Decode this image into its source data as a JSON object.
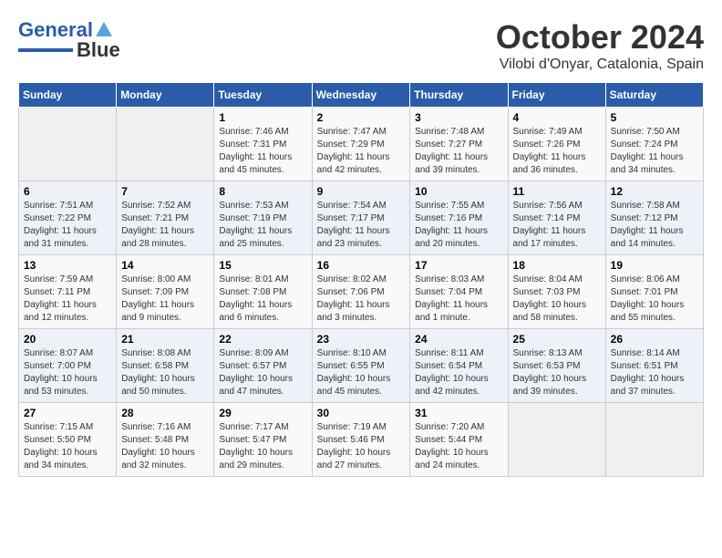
{
  "logo": {
    "line1": "General",
    "line2": "Blue"
  },
  "title": "October 2024",
  "subtitle": "Vilobi d'Onyar, Catalonia, Spain",
  "days_of_week": [
    "Sunday",
    "Monday",
    "Tuesday",
    "Wednesday",
    "Thursday",
    "Friday",
    "Saturday"
  ],
  "weeks": [
    [
      {
        "day": "",
        "info": ""
      },
      {
        "day": "",
        "info": ""
      },
      {
        "day": "1",
        "info": "Sunrise: 7:46 AM\nSunset: 7:31 PM\nDaylight: 11 hours and 45 minutes."
      },
      {
        "day": "2",
        "info": "Sunrise: 7:47 AM\nSunset: 7:29 PM\nDaylight: 11 hours and 42 minutes."
      },
      {
        "day": "3",
        "info": "Sunrise: 7:48 AM\nSunset: 7:27 PM\nDaylight: 11 hours and 39 minutes."
      },
      {
        "day": "4",
        "info": "Sunrise: 7:49 AM\nSunset: 7:26 PM\nDaylight: 11 hours and 36 minutes."
      },
      {
        "day": "5",
        "info": "Sunrise: 7:50 AM\nSunset: 7:24 PM\nDaylight: 11 hours and 34 minutes."
      }
    ],
    [
      {
        "day": "6",
        "info": "Sunrise: 7:51 AM\nSunset: 7:22 PM\nDaylight: 11 hours and 31 minutes."
      },
      {
        "day": "7",
        "info": "Sunrise: 7:52 AM\nSunset: 7:21 PM\nDaylight: 11 hours and 28 minutes."
      },
      {
        "day": "8",
        "info": "Sunrise: 7:53 AM\nSunset: 7:19 PM\nDaylight: 11 hours and 25 minutes."
      },
      {
        "day": "9",
        "info": "Sunrise: 7:54 AM\nSunset: 7:17 PM\nDaylight: 11 hours and 23 minutes."
      },
      {
        "day": "10",
        "info": "Sunrise: 7:55 AM\nSunset: 7:16 PM\nDaylight: 11 hours and 20 minutes."
      },
      {
        "day": "11",
        "info": "Sunrise: 7:56 AM\nSunset: 7:14 PM\nDaylight: 11 hours and 17 minutes."
      },
      {
        "day": "12",
        "info": "Sunrise: 7:58 AM\nSunset: 7:12 PM\nDaylight: 11 hours and 14 minutes."
      }
    ],
    [
      {
        "day": "13",
        "info": "Sunrise: 7:59 AM\nSunset: 7:11 PM\nDaylight: 11 hours and 12 minutes."
      },
      {
        "day": "14",
        "info": "Sunrise: 8:00 AM\nSunset: 7:09 PM\nDaylight: 11 hours and 9 minutes."
      },
      {
        "day": "15",
        "info": "Sunrise: 8:01 AM\nSunset: 7:08 PM\nDaylight: 11 hours and 6 minutes."
      },
      {
        "day": "16",
        "info": "Sunrise: 8:02 AM\nSunset: 7:06 PM\nDaylight: 11 hours and 3 minutes."
      },
      {
        "day": "17",
        "info": "Sunrise: 8:03 AM\nSunset: 7:04 PM\nDaylight: 11 hours and 1 minute."
      },
      {
        "day": "18",
        "info": "Sunrise: 8:04 AM\nSunset: 7:03 PM\nDaylight: 10 hours and 58 minutes."
      },
      {
        "day": "19",
        "info": "Sunrise: 8:06 AM\nSunset: 7:01 PM\nDaylight: 10 hours and 55 minutes."
      }
    ],
    [
      {
        "day": "20",
        "info": "Sunrise: 8:07 AM\nSunset: 7:00 PM\nDaylight: 10 hours and 53 minutes."
      },
      {
        "day": "21",
        "info": "Sunrise: 8:08 AM\nSunset: 6:58 PM\nDaylight: 10 hours and 50 minutes."
      },
      {
        "day": "22",
        "info": "Sunrise: 8:09 AM\nSunset: 6:57 PM\nDaylight: 10 hours and 47 minutes."
      },
      {
        "day": "23",
        "info": "Sunrise: 8:10 AM\nSunset: 6:55 PM\nDaylight: 10 hours and 45 minutes."
      },
      {
        "day": "24",
        "info": "Sunrise: 8:11 AM\nSunset: 6:54 PM\nDaylight: 10 hours and 42 minutes."
      },
      {
        "day": "25",
        "info": "Sunrise: 8:13 AM\nSunset: 6:53 PM\nDaylight: 10 hours and 39 minutes."
      },
      {
        "day": "26",
        "info": "Sunrise: 8:14 AM\nSunset: 6:51 PM\nDaylight: 10 hours and 37 minutes."
      }
    ],
    [
      {
        "day": "27",
        "info": "Sunrise: 7:15 AM\nSunset: 5:50 PM\nDaylight: 10 hours and 34 minutes."
      },
      {
        "day": "28",
        "info": "Sunrise: 7:16 AM\nSunset: 5:48 PM\nDaylight: 10 hours and 32 minutes."
      },
      {
        "day": "29",
        "info": "Sunrise: 7:17 AM\nSunset: 5:47 PM\nDaylight: 10 hours and 29 minutes."
      },
      {
        "day": "30",
        "info": "Sunrise: 7:19 AM\nSunset: 5:46 PM\nDaylight: 10 hours and 27 minutes."
      },
      {
        "day": "31",
        "info": "Sunrise: 7:20 AM\nSunset: 5:44 PM\nDaylight: 10 hours and 24 minutes."
      },
      {
        "day": "",
        "info": ""
      },
      {
        "day": "",
        "info": ""
      }
    ]
  ]
}
